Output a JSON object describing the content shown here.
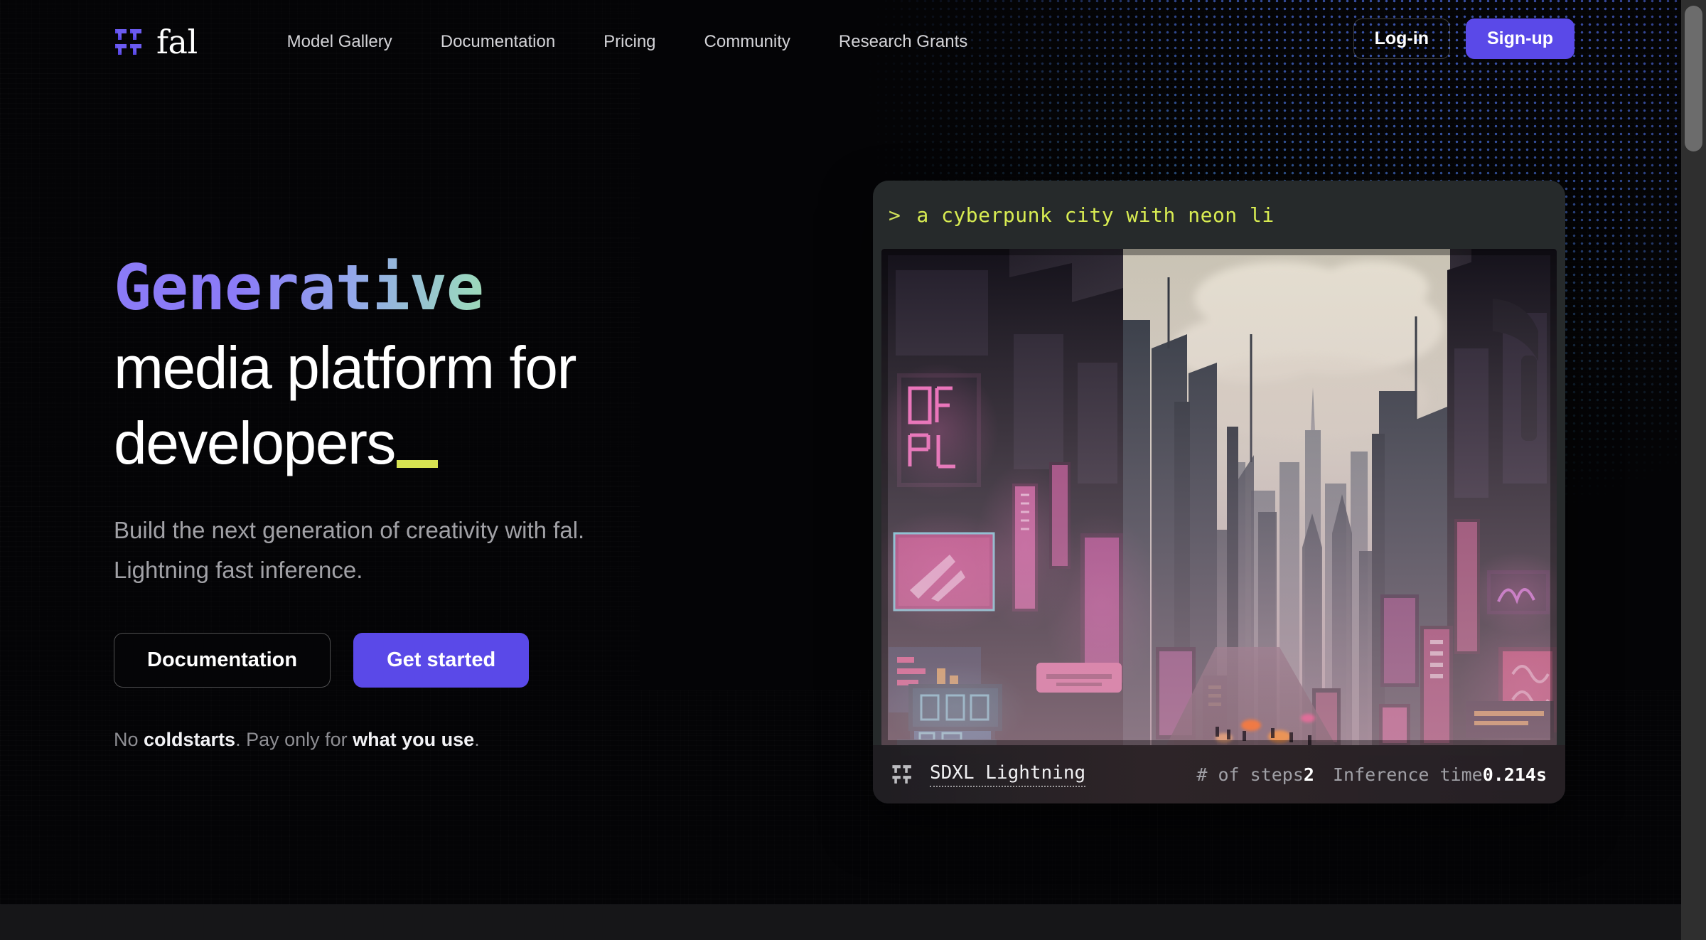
{
  "brand": {
    "name": "fal",
    "logo_icon": "fal-logo-icon",
    "accent": "#5a49e8"
  },
  "header": {
    "nav": [
      {
        "label": "Model Gallery",
        "name": "nav-model-gallery"
      },
      {
        "label": "Documentation",
        "name": "nav-documentation"
      },
      {
        "label": "Pricing",
        "name": "nav-pricing"
      },
      {
        "label": "Community",
        "name": "nav-community"
      },
      {
        "label": "Research Grants",
        "name": "nav-research-grants"
      }
    ],
    "login_label": "Log-in",
    "signup_label": "Sign-up"
  },
  "hero": {
    "headline_gradient_word": "Generative",
    "headline_line2": "media platform for",
    "headline_line3": "developers",
    "caret_color": "#d7e352",
    "subtitle_line1": "Build the next generation of creativity with fal.",
    "subtitle_line2": "Lightning fast inference.",
    "cta_primary": "Get started",
    "cta_secondary": "Documentation",
    "note": {
      "part1": "No ",
      "bold1": "coldstarts",
      "part2": ". Pay only for ",
      "bold2": "what you use",
      "part3": "."
    }
  },
  "demo_card": {
    "prompt_chevron": ">",
    "prompt_text": "a cyberpunk city with neon li",
    "image_alt": "generated cyberpunk city with neon lights",
    "model_name": "SDXL Lightning",
    "steps_label": "# of steps",
    "steps_value": "2",
    "inference_label": "Inference time",
    "inference_value": "0.214s",
    "logo_icon": "fal-logo-icon"
  },
  "scrollbar": {
    "name": "vertical-scrollbar"
  }
}
